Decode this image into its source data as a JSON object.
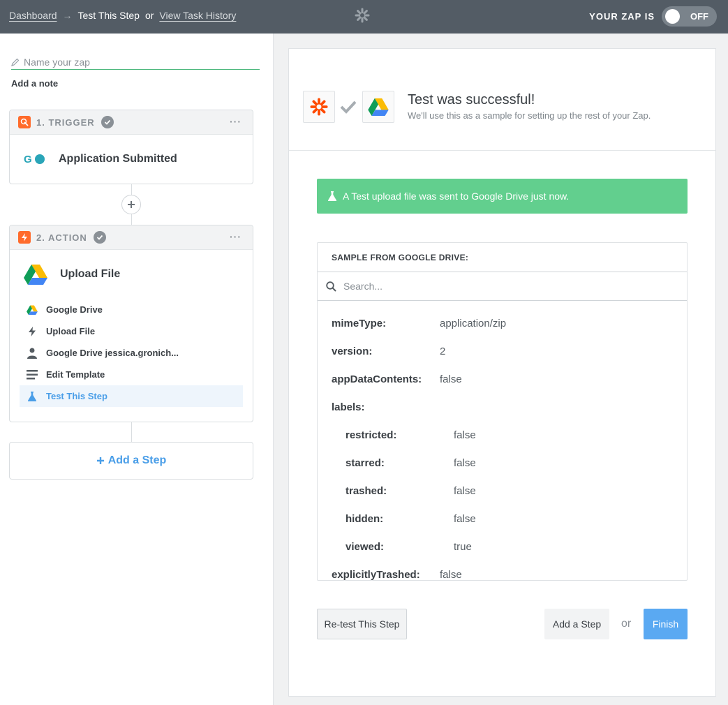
{
  "header": {
    "dashboard_label": "Dashboard",
    "arrow": "→",
    "current_label": "Test This Step",
    "or_label": "or",
    "history_label": "View Task History",
    "zap_is_label": "YOUR ZAP IS",
    "toggle_label": "OFF"
  },
  "sidebar": {
    "zap_name_placeholder": "Name your zap",
    "add_note": "Add a note",
    "trigger": {
      "title": "1. TRIGGER",
      "app_name": "Application Submitted",
      "menu": "···"
    },
    "action": {
      "title": "2. ACTION",
      "app_name": "Upload File",
      "menu": "···",
      "substeps": [
        {
          "label": "Google Drive",
          "icon": "google-drive-icon"
        },
        {
          "label": "Upload File",
          "icon": "bolt-icon"
        },
        {
          "label": "Google Drive jessica.gronich...",
          "icon": "user-icon"
        },
        {
          "label": "Edit Template",
          "icon": "list-icon"
        },
        {
          "label": "Test This Step",
          "icon": "flask-icon",
          "active": true
        }
      ]
    },
    "add_step": "Add a Step"
  },
  "main": {
    "success_title": "Test was successful!",
    "success_subtitle": "We'll use this as a sample for setting up the rest of your Zap.",
    "alert_text": "A Test upload file was sent to Google Drive just now.",
    "sample_title": "SAMPLE FROM GOOGLE DRIVE:",
    "search_placeholder": "Search...",
    "fields": [
      {
        "key": "mimeType:",
        "value": "application/zip",
        "indent": 0
      },
      {
        "key": "version:",
        "value": "2",
        "indent": 0
      },
      {
        "key": "appDataContents:",
        "value": "false",
        "indent": 0
      },
      {
        "key": "labels:",
        "value": "",
        "indent": 0
      },
      {
        "key": "restricted:",
        "value": "false",
        "indent": 1
      },
      {
        "key": "starred:",
        "value": "false",
        "indent": 1
      },
      {
        "key": "trashed:",
        "value": "false",
        "indent": 1
      },
      {
        "key": "hidden:",
        "value": "false",
        "indent": 1
      },
      {
        "key": "viewed:",
        "value": "true",
        "indent": 1
      },
      {
        "key": "explicitlyTrashed:",
        "value": "false",
        "indent": 0
      }
    ],
    "retest_button": "Re-test This Step",
    "add_step_button": "Add a Step",
    "or_text": "or",
    "finish_button": "Finish"
  },
  "colors": {
    "header_bg": "#535c65",
    "accent_orange": "#ff6b2b",
    "success_green": "#62cf8e",
    "link_blue": "#4a9ee8",
    "finish_blue": "#5aa9f2"
  }
}
